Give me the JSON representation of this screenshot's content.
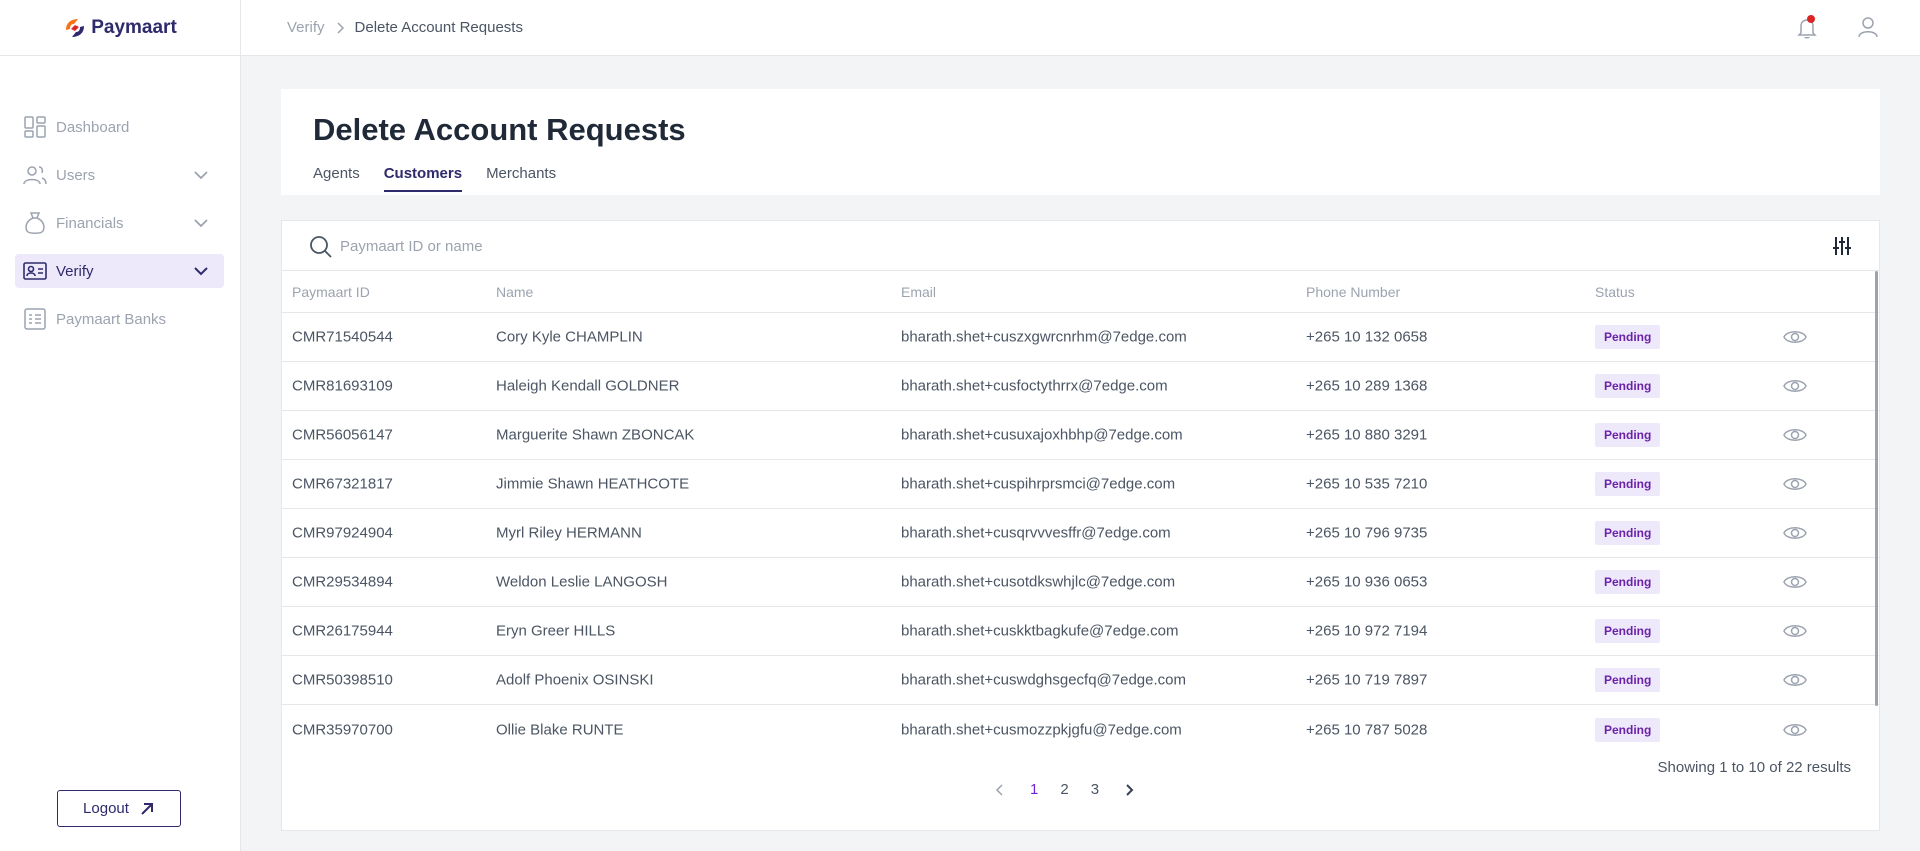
{
  "brand": {
    "name": "Paymaart",
    "accent": "#2e2a6b"
  },
  "sidebar": {
    "items": [
      {
        "label": "Dashboard",
        "icon": "dashboard-icon",
        "expandable": false,
        "active": false
      },
      {
        "label": "Users",
        "icon": "users-icon",
        "expandable": true,
        "active": false
      },
      {
        "label": "Financials",
        "icon": "money-bag-icon",
        "expandable": true,
        "active": false
      },
      {
        "label": "Verify",
        "icon": "id-card-icon",
        "expandable": true,
        "active": true
      },
      {
        "label": "Paymaart Banks",
        "icon": "bank-list-icon",
        "expandable": false,
        "active": false
      }
    ],
    "logout_label": "Logout"
  },
  "header": {
    "breadcrumb": [
      "Verify",
      "Delete Account Requests"
    ],
    "notification_count_dot": true
  },
  "page": {
    "title": "Delete Account Requests",
    "tabs": [
      {
        "label": "Agents",
        "active": false
      },
      {
        "label": "Customers",
        "active": true
      },
      {
        "label": "Merchants",
        "active": false
      }
    ]
  },
  "search": {
    "placeholder": "Paymaart ID or name",
    "value": ""
  },
  "table": {
    "columns": [
      "Paymaart ID",
      "Name",
      "Email",
      "Phone Number",
      "Status"
    ],
    "rows": [
      {
        "id": "CMR71540544",
        "name": "Cory Kyle CHAMPLIN",
        "email": "bharath.shet+cuszxgwrcnrhm@7edge.com",
        "phone": "+265 10 132 0658",
        "status": "Pending"
      },
      {
        "id": "CMR81693109",
        "name": "Haleigh Kendall GOLDNER",
        "email": "bharath.shet+cusfoctythrrx@7edge.com",
        "phone": "+265 10 289 1368",
        "status": "Pending"
      },
      {
        "id": "CMR56056147",
        "name": "Marguerite Shawn ZBONCAK",
        "email": "bharath.shet+cusuxajoxhbhp@7edge.com",
        "phone": "+265 10 880 3291",
        "status": "Pending"
      },
      {
        "id": "CMR67321817",
        "name": "Jimmie Shawn HEATHCOTE",
        "email": "bharath.shet+cuspihrprsmci@7edge.com",
        "phone": "+265 10 535 7210",
        "status": "Pending"
      },
      {
        "id": "CMR97924904",
        "name": "Myrl Riley HERMANN",
        "email": "bharath.shet+cusqrvvvesffr@7edge.com",
        "phone": "+265 10 796 9735",
        "status": "Pending"
      },
      {
        "id": "CMR29534894",
        "name": "Weldon Leslie LANGOSH",
        "email": "bharath.shet+cusotdkswhjlc@7edge.com",
        "phone": "+265 10 936 0653",
        "status": "Pending"
      },
      {
        "id": "CMR26175944",
        "name": "Eryn Greer HILLS",
        "email": "bharath.shet+cuskktbagkufe@7edge.com",
        "phone": "+265 10 972 7194",
        "status": "Pending"
      },
      {
        "id": "CMR50398510",
        "name": "Adolf Phoenix OSINSKI",
        "email": "bharath.shet+cuswdghsgecfq@7edge.com",
        "phone": "+265 10 719 7897",
        "status": "Pending"
      },
      {
        "id": "CMR35970700",
        "name": "Ollie Blake RUNTE",
        "email": "bharath.shet+cusmozzpkjgfu@7edge.com",
        "phone": "+265 10 787 5028",
        "status": "Pending"
      }
    ]
  },
  "results_text": "Showing 1 to 10 of 22 results",
  "pagination": {
    "pages": [
      "1",
      "2",
      "3"
    ],
    "current": "1"
  }
}
